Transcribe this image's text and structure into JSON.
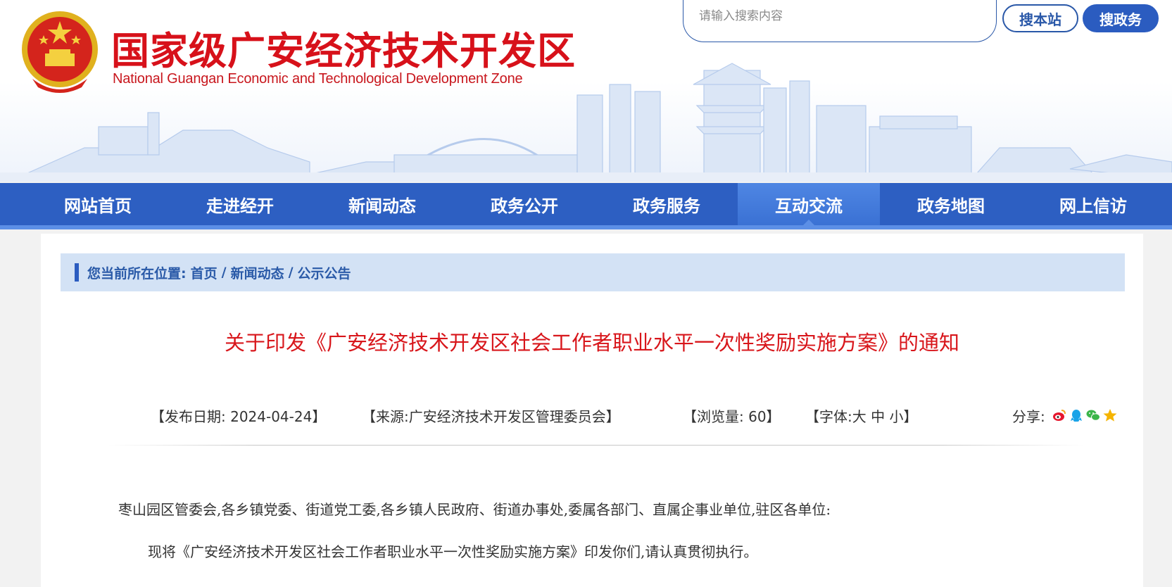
{
  "header": {
    "title": "国家级广安经济技术开发区",
    "subtitle": "National Guangan Economic and Technological Development Zone",
    "search_placeholder": "请输入搜索内容",
    "btn_site": "搜本站",
    "btn_gov": "搜政务"
  },
  "nav": [
    {
      "label": "网站首页"
    },
    {
      "label": "走进经开"
    },
    {
      "label": "新闻动态"
    },
    {
      "label": "政务公开"
    },
    {
      "label": "政务服务"
    },
    {
      "label": "互动交流",
      "active": true
    },
    {
      "label": "政务地图"
    },
    {
      "label": "网上信访"
    }
  ],
  "breadcrumb": {
    "prefix": "您当前所在位置:",
    "items": [
      "首页",
      "新闻动态",
      "公示公告"
    ],
    "separator": "/"
  },
  "article": {
    "title": "关于印发《广安经济技术开发区社会工作者职业水平一次性奖励实施方案》的通知",
    "publish_label": "【发布日期:   2024-04-24】",
    "source_label": "【来源:广安经济技术开发区管理委员会】",
    "views_label": "【浏览量: 60】",
    "font_prefix": "【字体:",
    "font_large": "大",
    "font_medium": "中",
    "font_small": "小",
    "font_suffix": "】",
    "share_label": "分享:",
    "share_icons": [
      "weibo-icon",
      "qq-icon",
      "wechat-icon",
      "favorite-star-icon"
    ],
    "paragraphs": [
      "枣山园区管委会,各乡镇党委、街道党工委,各乡镇人民政府、街道办事处,委属各部门、直属企事业单位,驻区各单位:",
      "现将《广安经济技术开发区社会工作者职业水平一次性奖励实施方案》印发你们,请认真贯彻执行。"
    ]
  },
  "colors": {
    "brand_red": "#d7111a",
    "nav_blue": "#2d5fc2",
    "breadcrumb_bg": "#d3e2f5"
  }
}
